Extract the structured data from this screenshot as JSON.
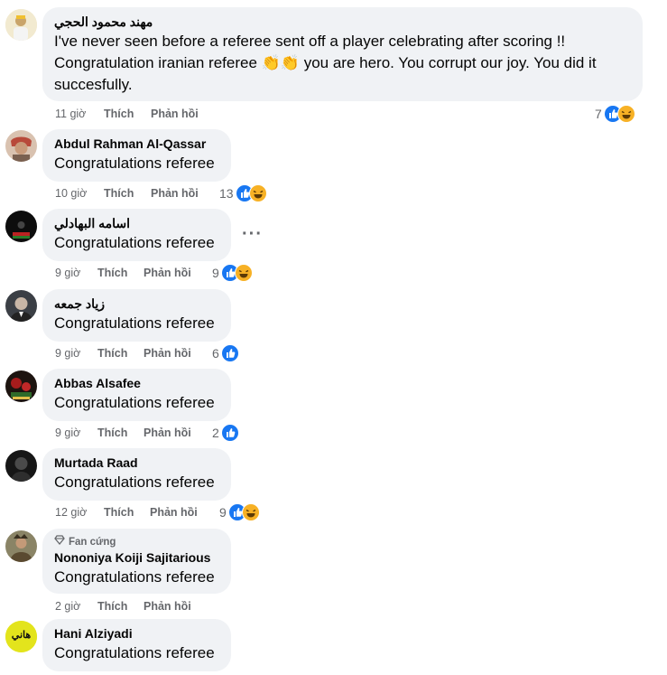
{
  "comments": [
    {
      "author": "مهند محمود الحجي",
      "text": "I've never seen before a referee sent off a player celebrating after scoring !! Congratulation iranian referee 👏👏 you are hero. You corrupt our joy. You did it succesfully.",
      "time": "11 giờ",
      "like_label": "Thích",
      "reply_label": "Phản hồi",
      "reactions": "7",
      "reaction_types": [
        "like",
        "haha"
      ],
      "avatar_color": "#e7d9a8"
    },
    {
      "author": "Abdul Rahman Al-Qassar",
      "text": "Congratulations referee",
      "time": "10 giờ",
      "like_label": "Thích",
      "reply_label": "Phản hồi",
      "reactions": "13",
      "reaction_types": [
        "like",
        "haha"
      ],
      "avatar_color": "#b06a5a"
    },
    {
      "author": "اسامه البهادلي",
      "text": "Congratulations referee",
      "time": "9 giờ",
      "like_label": "Thích",
      "reply_label": "Phản hồi",
      "reactions": "9",
      "reaction_types": [
        "like",
        "haha"
      ],
      "avatar_color": "#1a1a1a",
      "more_label": "···"
    },
    {
      "author": "زياد جمعه",
      "text": "Congratulations referee",
      "time": "9 giờ",
      "like_label": "Thích",
      "reply_label": "Phản hồi",
      "reactions": "6",
      "reaction_types": [
        "like"
      ],
      "avatar_color": "#555b63"
    },
    {
      "author": "Abbas Alsafee",
      "text": "Congratulations referee",
      "time": "9 giờ",
      "like_label": "Thích",
      "reply_label": "Phản hồi",
      "reactions": "2",
      "reaction_types": [
        "like"
      ],
      "avatar_color": "#3a2a1e"
    },
    {
      "author": "Murtada Raad",
      "text": "Congratulations referee",
      "time": "12 giờ",
      "like_label": "Thích",
      "reply_label": "Phản hồi",
      "reactions": "9",
      "reaction_types": [
        "like",
        "haha"
      ],
      "avatar_color": "#2b2b2b"
    },
    {
      "badge": "Fan cứng",
      "author": "Nononiya Koiji Sajitarious",
      "text": "Congratulations referee",
      "time": "2 giờ",
      "like_label": "Thích",
      "reply_label": "Phản hồi",
      "avatar_color": "#6f6a52"
    },
    {
      "author": "Hani Alziyadi",
      "text": "Congratulations referee",
      "avatar_color": "#e5e61a",
      "avatar_text": "هاني"
    }
  ],
  "colors": {
    "like": "#1877f2",
    "haha": "#f7b125",
    "bubble": "#f0f2f5",
    "meta": "#65676b"
  }
}
